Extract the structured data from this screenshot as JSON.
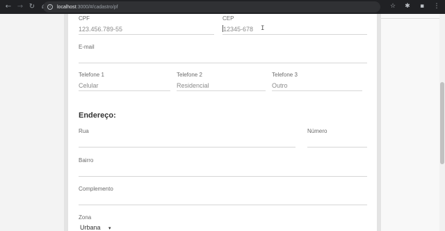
{
  "browser": {
    "url_host": "localhost",
    "url_rest": ":3000/#/cadastro/pf"
  },
  "form": {
    "cpf": {
      "label": "CPF",
      "value": "123.456.789-55"
    },
    "cep": {
      "label": "CEP",
      "value": "12345-678"
    },
    "email": {
      "label": "E-mail",
      "value": ""
    },
    "tel1": {
      "label": "Telefone 1",
      "placeholder": "Celular"
    },
    "tel2": {
      "label": "Telefone 2",
      "placeholder": "Residencial"
    },
    "tel3": {
      "label": "Telefone 3",
      "placeholder": "Outro"
    },
    "address_title": "Endereço:",
    "rua": {
      "label": "Rua",
      "value": ""
    },
    "numero": {
      "label": "Número",
      "value": ""
    },
    "bairro": {
      "label": "Bairro",
      "value": ""
    },
    "complemento": {
      "label": "Complemento",
      "value": ""
    },
    "zona": {
      "label": "Zona",
      "selected": "Urbana"
    }
  }
}
